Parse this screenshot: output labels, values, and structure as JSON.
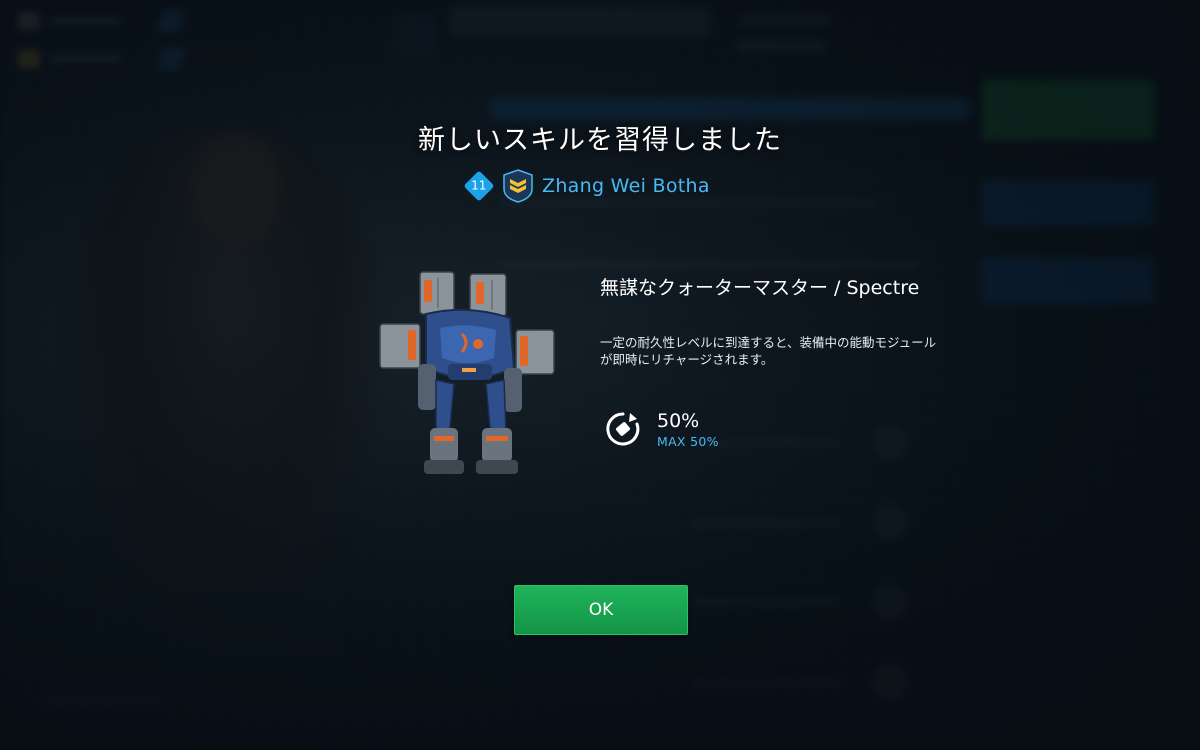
{
  "modal": {
    "title": "新しいスキルを習得しました",
    "pilot": {
      "level": "11",
      "rank_icon": "chevron-rank-badge-icon",
      "name": "Zhang Wei Botha"
    },
    "robot_icon": "robot-spectre-icon",
    "skill": {
      "name": "無謀なクォーターマスター / Spectre",
      "description": "一定の耐久性レベルに到達すると、装備中の能動モジュールが即時にリチャージされます。",
      "stat_icon": "recharge-cycle-icon",
      "value": "50%",
      "max": "MAX 50%"
    },
    "ok_label": "OK"
  },
  "colors": {
    "accent_blue": "#4ab8f2",
    "level_badge": "#1aa3e8",
    "ok_green": "#1aa552",
    "background": "#0e1a24"
  }
}
